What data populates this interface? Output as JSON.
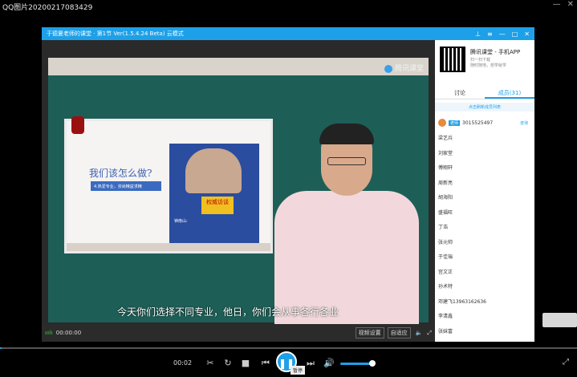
{
  "viewer": {
    "title": "QQ图片20200217083429",
    "minimize": "—",
    "close": "✕",
    "time": "00:02",
    "pause_tooltip": "暂停",
    "fullscreen_icon": "⤢"
  },
  "app": {
    "title": "于德夏老师的课堂 · 第1节 Ver(1.5.4.24 Beta)  云模式",
    "watermark": "腾讯课堂",
    "subtitle": "今天你们选择不同专业，他日，你们会从事各行各业",
    "slide_heading": "我们该怎么做?",
    "slide_sub": "4.热爱专业，崇尚精益求精",
    "poster_tag": "权威访谈",
    "poster_text": "钟南山:",
    "bottom": {
      "signal": "ııılı",
      "time": "00:00:00",
      "btn1": "视频设置",
      "btn2": "自适应"
    }
  },
  "side": {
    "app_name": "腾讯课堂 - 手机APP",
    "app_desc1": "扫一扫下载",
    "app_desc2": "随时随地，想学就学",
    "tab_discuss": "讨论",
    "tab_members": "成员(31)",
    "refresh": "点击刷新成员列表",
    "teacher_badge": "老师",
    "teacher_id": "3015525497",
    "teacher_link": "咨询",
    "members": [
      "梁艺兵",
      "刘家堂",
      "傅翔轩",
      "周新亮",
      "胡海阳",
      "盛福旺",
      "丁浩",
      "张元帅",
      "于佳瑞",
      "宫文正",
      "孙术特",
      "邓建飞13963162636",
      "李清鑫",
      "张妹富"
    ]
  }
}
